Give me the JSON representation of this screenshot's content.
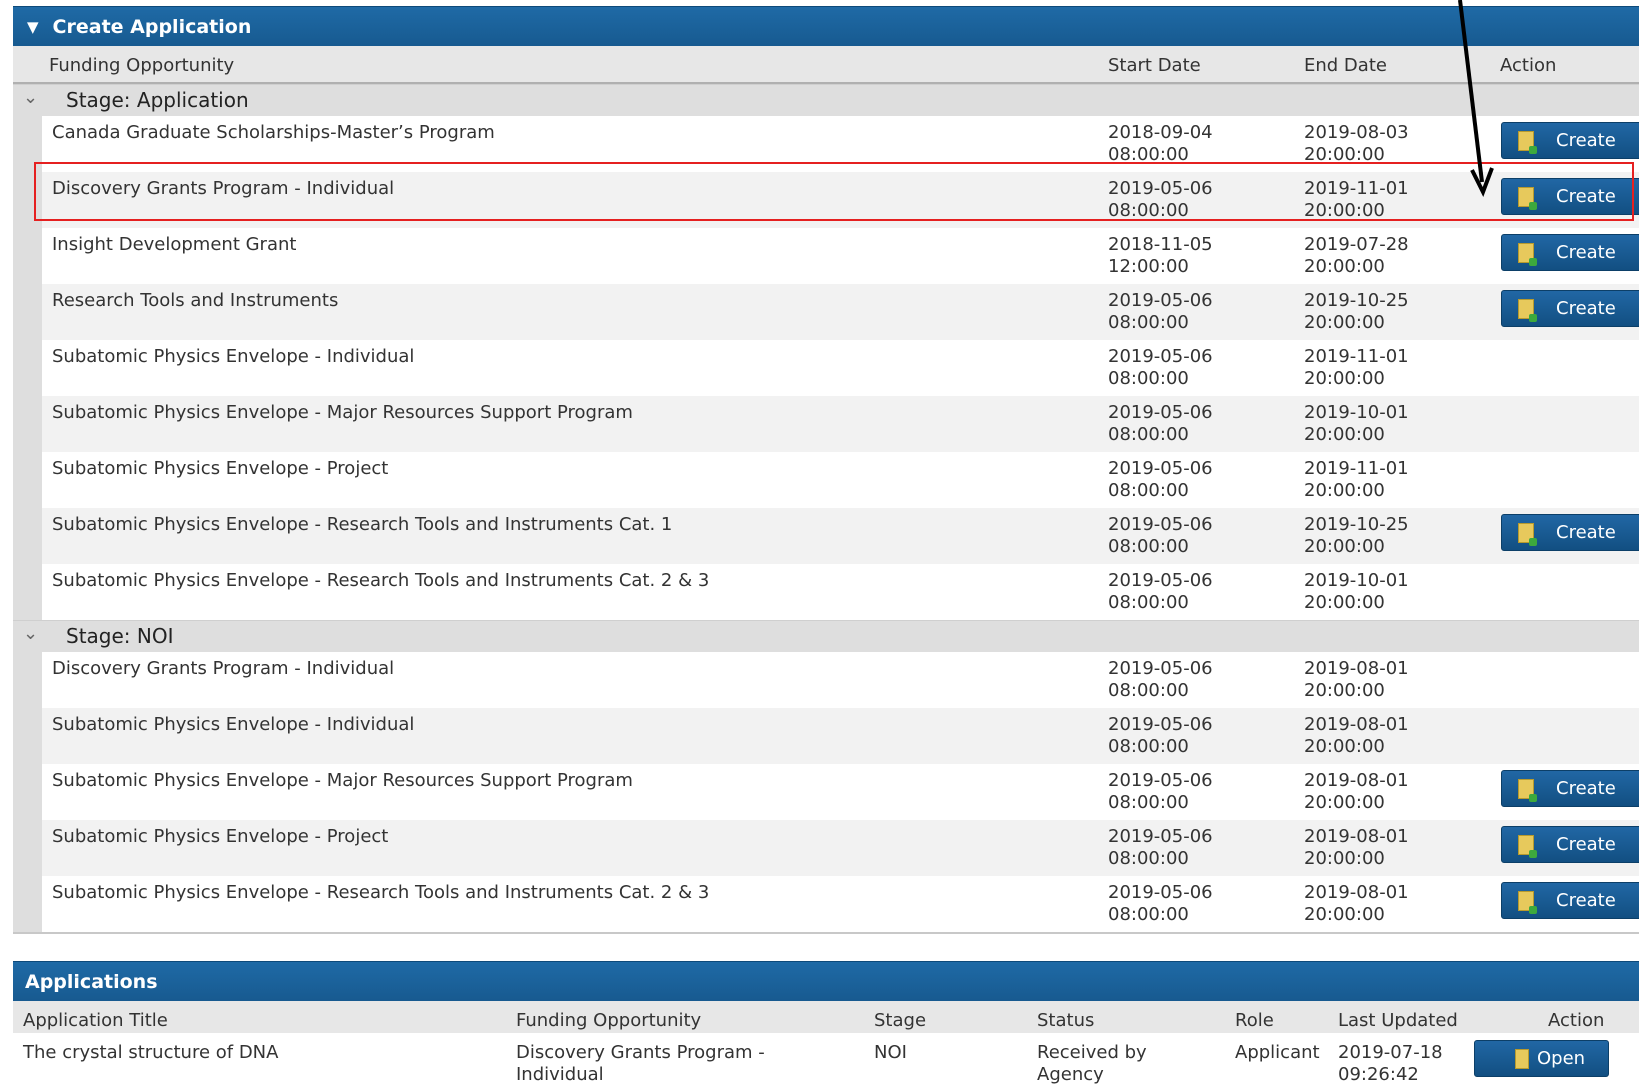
{
  "create_panel": {
    "title": "Create Application",
    "columns": {
      "funding": "Funding Opportunity",
      "start": "Start Date",
      "end": "End Date",
      "action": "Action"
    },
    "stages": [
      {
        "label": "Stage: Application",
        "rows": [
          {
            "title": "Canada Graduate Scholarships-Master’s Program",
            "start": "2018-09-04\n08:00:00",
            "end": "2019-08-03\n20:00:00",
            "action": "Create"
          },
          {
            "title": "Discovery Grants Program - Individual",
            "start": "2019-05-06\n08:00:00",
            "end": "2019-11-01\n20:00:00",
            "action": "Create"
          },
          {
            "title": "Insight Development Grant",
            "start": "2018-11-05\n12:00:00",
            "end": "2019-07-28\n20:00:00",
            "action": "Create"
          },
          {
            "title": "Research Tools and Instruments",
            "start": "2019-05-06\n08:00:00",
            "end": "2019-10-25\n20:00:00",
            "action": "Create"
          },
          {
            "title": "Subatomic Physics Envelope - Individual",
            "start": "2019-05-06\n08:00:00",
            "end": "2019-11-01\n20:00:00",
            "action": ""
          },
          {
            "title": "Subatomic Physics Envelope - Major Resources Support Program",
            "start": "2019-05-06\n08:00:00",
            "end": "2019-10-01\n20:00:00",
            "action": ""
          },
          {
            "title": "Subatomic Physics Envelope - Project",
            "start": "2019-05-06\n08:00:00",
            "end": "2019-11-01\n20:00:00",
            "action": ""
          },
          {
            "title": "Subatomic Physics Envelope - Research Tools and Instruments Cat. 1",
            "start": "2019-05-06\n08:00:00",
            "end": "2019-10-25\n20:00:00",
            "action": "Create"
          },
          {
            "title": "Subatomic Physics Envelope - Research Tools and Instruments Cat. 2 & 3",
            "start": "2019-05-06\n08:00:00",
            "end": "2019-10-01\n20:00:00",
            "action": ""
          }
        ]
      },
      {
        "label": "Stage: NOI",
        "rows": [
          {
            "title": "Discovery Grants Program - Individual",
            "start": "2019-05-06\n08:00:00",
            "end": "2019-08-01\n20:00:00",
            "action": ""
          },
          {
            "title": "Subatomic Physics Envelope - Individual",
            "start": "2019-05-06\n08:00:00",
            "end": "2019-08-01\n20:00:00",
            "action": ""
          },
          {
            "title": "Subatomic Physics Envelope - Major Resources Support Program",
            "start": "2019-05-06\n08:00:00",
            "end": "2019-08-01\n20:00:00",
            "action": "Create"
          },
          {
            "title": "Subatomic Physics Envelope - Project",
            "start": "2019-05-06\n08:00:00",
            "end": "2019-08-01\n20:00:00",
            "action": "Create"
          },
          {
            "title": "Subatomic Physics Envelope - Research Tools and Instruments Cat. 2 & 3",
            "start": "2019-05-06\n08:00:00",
            "end": "2019-08-01\n20:00:00",
            "action": "Create"
          }
        ]
      }
    ]
  },
  "applications_panel": {
    "title": "Applications",
    "columns": {
      "title": "Application Title",
      "funding": "Funding Opportunity",
      "stage": "Stage",
      "status": "Status",
      "role": "Role",
      "updated": "Last Updated",
      "action": "Action"
    },
    "rows": [
      {
        "title": "The crystal structure of DNA",
        "funding": "Discovery Grants Program -\nIndividual",
        "stage": "NOI",
        "status": "Received by\nAgency",
        "role": "Applicant",
        "updated": "2019-07-18\n09:26:42",
        "action": "Open"
      }
    ]
  },
  "colors": {
    "header_blue": "#1f6aa6",
    "button_blue": "#124f82",
    "highlight_red": "#e52020"
  }
}
